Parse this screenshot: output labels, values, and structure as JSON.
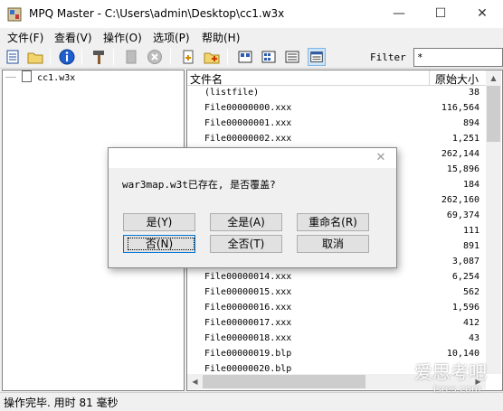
{
  "window": {
    "title": "MPQ Master - C:\\Users\\admin\\Desktop\\cc1.w3x",
    "minimize": "—",
    "maximize": "☐",
    "close": "✕"
  },
  "menu": [
    "文件(F)",
    "查看(V)",
    "操作(O)",
    "选项(P)",
    "帮助(H)"
  ],
  "toolbar": {
    "icons": [
      "new-file-icon",
      "open-folder-icon",
      "info-icon",
      "hammer-icon",
      "disabled-doc-icon",
      "disabled-cancel-icon",
      "add-file-icon",
      "add-folder-icon",
      "view-large-icons-icon",
      "view-small-icons-icon",
      "view-list-icon",
      "view-details-icon"
    ],
    "filter_label": "Filter",
    "filter_value": "*"
  },
  "tree": {
    "node": "cc1.w3x"
  },
  "list": {
    "columns": [
      "文件名",
      "原始大小"
    ],
    "rows": [
      {
        "name": "(listfile)",
        "size": "38"
      },
      {
        "name": "File00000000.xxx",
        "size": "116,564"
      },
      {
        "name": "File00000001.xxx",
        "size": "894"
      },
      {
        "name": "File00000002.xxx",
        "size": "1,251"
      },
      {
        "name": "",
        "size": "262,144"
      },
      {
        "name": "",
        "size": "15,896"
      },
      {
        "name": "",
        "size": "184"
      },
      {
        "name": "",
        "size": "262,160"
      },
      {
        "name": "",
        "size": "69,374"
      },
      {
        "name": "",
        "size": "111"
      },
      {
        "name": "",
        "size": "891"
      },
      {
        "name": "",
        "size": "3,087"
      },
      {
        "name": "File00000014.xxx",
        "size": "6,254"
      },
      {
        "name": "File00000015.xxx",
        "size": "562"
      },
      {
        "name": "File00000016.xxx",
        "size": "1,596"
      },
      {
        "name": "File00000017.xxx",
        "size": "412"
      },
      {
        "name": "File00000018.xxx",
        "size": "43"
      },
      {
        "name": "File00000019.blp",
        "size": "10,140"
      },
      {
        "name": "File00000020.blp",
        "size": ""
      }
    ]
  },
  "dialog": {
    "close": "✕",
    "message": "war3map.w3t已存在, 是否覆盖?",
    "buttons": {
      "yes": "是(Y)",
      "yes_all": "全是(A)",
      "rename": "重命名(R)",
      "no": "否(N)",
      "no_all": "全否(T)",
      "cancel": "取消"
    }
  },
  "status": "操作完毕. 用时 81 毫秒",
  "watermark": {
    "main": "爱思考吧",
    "sub": "isres.com"
  }
}
